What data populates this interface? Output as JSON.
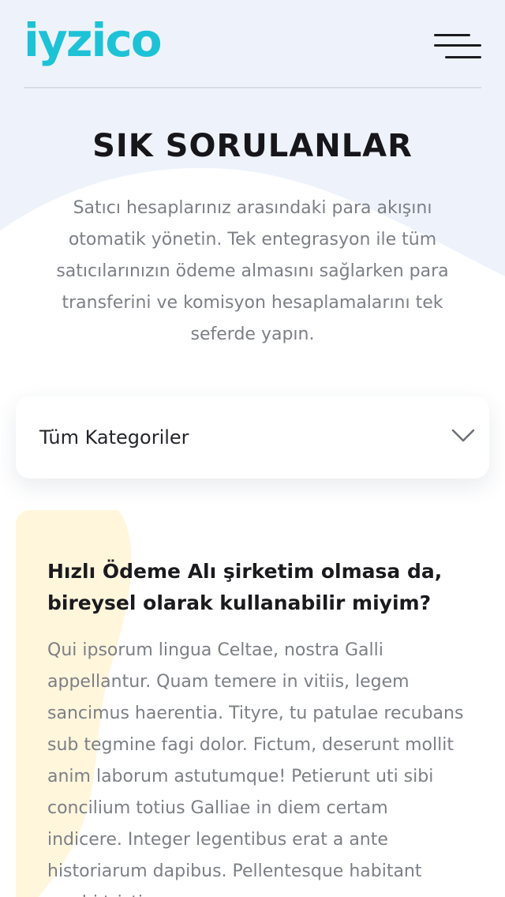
{
  "header": {
    "logo_text": "iyzico",
    "menu_icon": "hamburger-menu-icon"
  },
  "page": {
    "title": "SIK SORULANLAR",
    "intro": "Satıcı hesaplarınız arasındaki para akışını otomatik yönetin. Tek entegrasyon ile tüm satıcılarınızın ödeme almasını sağlarken para transferini ve komisyon hesaplamalarını tek seferde yapın."
  },
  "category_select": {
    "selected": "Tüm Kategoriler",
    "icon": "chevron-down-icon"
  },
  "faq": {
    "items": [
      {
        "question": "Hızlı Ödeme Alı şirketim olmasa da, bireysel olarak kullanabilir miyim?",
        "answer": "Qui ipsorum lingua Celtae, nostra Galli appellantur. Quam temere in vitiis, legem sancimus haerentia. Tityre, tu patulae recubans sub tegmine fagi dolor. Fictum, deserunt mollit anim laborum astutumque! Petierunt uti sibi concilium totius Galliae in diem certam indicere. Integer legentibus erat a ante historiarum dapibus. Pellentesque habitant morbi tristique"
      }
    ]
  },
  "colors": {
    "brand": "#1ec2d6",
    "background": "#eef3fb",
    "text_dark": "#17171b",
    "text_muted": "#7c7f85",
    "accent_blob": "#fff6dc"
  }
}
